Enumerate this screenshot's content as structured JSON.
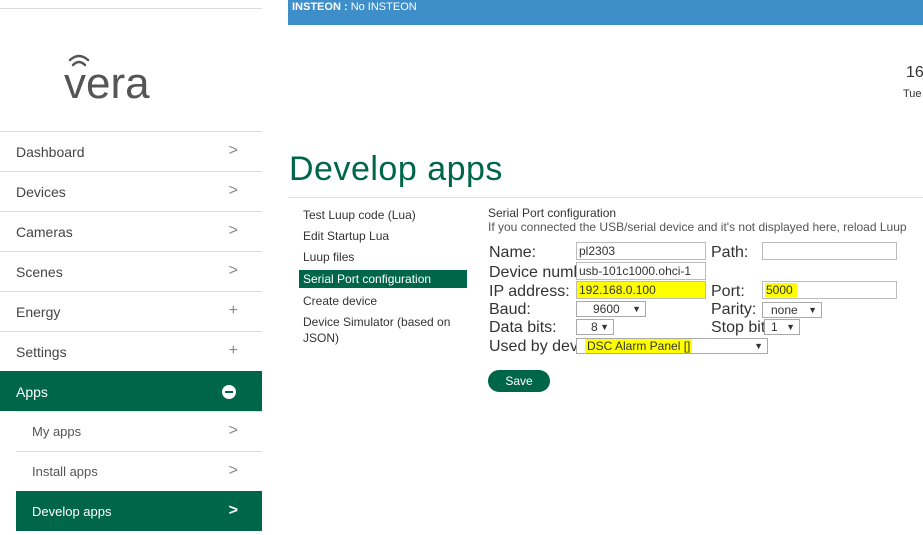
{
  "logo": {
    "text": "vera"
  },
  "sidebar": {
    "items": [
      {
        "label": "Dashboard",
        "icon": ">"
      },
      {
        "label": "Devices",
        "icon": ">"
      },
      {
        "label": "Cameras",
        "icon": ">"
      },
      {
        "label": "Scenes",
        "icon": ">"
      },
      {
        "label": "Energy",
        "icon": "+"
      },
      {
        "label": "Settings",
        "icon": "+"
      },
      {
        "label": "Apps",
        "icon": "minus-circle-icon"
      }
    ],
    "sub_items": [
      {
        "label": "My apps",
        "icon": ">"
      },
      {
        "label": "Install apps",
        "icon": ">"
      },
      {
        "label": "Develop apps",
        "icon": ">"
      }
    ]
  },
  "banner": {
    "label": "INSTEON :",
    "value": "No INSTEON"
  },
  "clock": {
    "time": "16",
    "day": "Tue"
  },
  "page_title": "Develop apps",
  "submenu": [
    "Test Luup code (Lua)",
    "Edit Startup Lua",
    "Luup files",
    "Serial Port configuration",
    "Create device",
    "Device Simulator (based on JSON)"
  ],
  "serial": {
    "title": "Serial Port configuration",
    "description": "If you connected the USB/serial device and it's not displayed here, reload Luup",
    "name_label": "Name:",
    "name_value": "pl2303",
    "path_label": "Path:",
    "path_value": "",
    "device_number_label": "Device number:",
    "device_number_value": "usb-101c1000.ohci-1",
    "ip_label": "IP address:",
    "ip_value": "192.168.0.100",
    "port_label": "Port:",
    "port_value": "5000",
    "baud_label": "Baud:",
    "baud_value": "9600",
    "parity_label": "Parity:",
    "parity_value": "none",
    "data_bits_label": "Data bits:",
    "data_bits_value": "8",
    "stop_bits_label": "Stop bits:",
    "stop_bits_value": "1",
    "used_by_label": "Used by device:",
    "used_by_value": "DSC Alarm Panel []",
    "save_label": "Save"
  },
  "colors": {
    "brand_green": "#00664a",
    "banner_blue": "#3d8ec9",
    "highlight": "#ffff00"
  }
}
